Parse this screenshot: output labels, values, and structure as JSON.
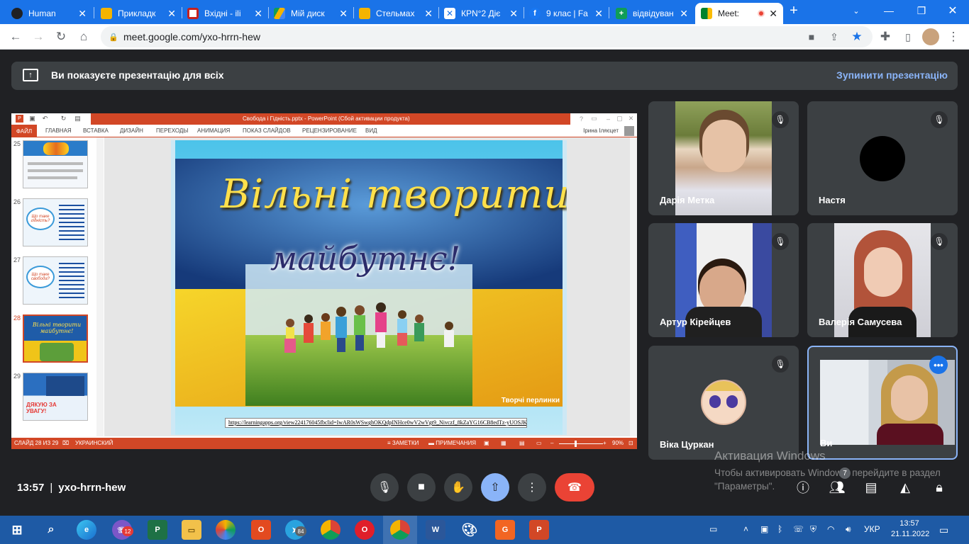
{
  "tabs": [
    {
      "title": "Human",
      "fav": "#5f6368",
      "active": false
    },
    {
      "title": "Прикладк",
      "fav": "#f4b400",
      "active": false
    },
    {
      "title": "Вхідні - ili",
      "fav": "#c5221f",
      "active": false
    },
    {
      "title": "Мій диск",
      "fav": "#0f9d58",
      "active": false
    },
    {
      "title": "Стельмах",
      "fav": "#f4b400",
      "active": false
    },
    {
      "title": "КРN°2 Діє",
      "fav": "#1a73e8",
      "active": false
    },
    {
      "title": "9 клас | Fa",
      "fav": "#1877f2",
      "active": false
    },
    {
      "title": "відвідуван",
      "fav": "#0f9d58",
      "active": false
    },
    {
      "title": "Meet:",
      "fav": "#00832d",
      "active": true
    }
  ],
  "address": {
    "url": "meet.google.com/yxo-hrrn-hew"
  },
  "banner": {
    "text": "Ви показуєте презентацію для всіх",
    "stop": "Зупинити презентацію"
  },
  "ppt": {
    "title": "Свобода і Гідність.pptx - PowerPoint (Сбой активации продукта)",
    "ribbon": {
      "file": "ФАЙЛ",
      "tabs": [
        "ГЛАВНАЯ",
        "ВСТАВКА",
        "ДИЗАЙН",
        "ПЕРЕХОДЫ",
        "АНИМАЦИЯ",
        "ПОКАЗ СЛАЙДОВ",
        "РЕЦЕНЗИРОВАНИЕ",
        "ВИД"
      ],
      "user": "Ірина Іляєцет"
    },
    "thumbs": [
      {
        "num": "25",
        "text": ""
      },
      {
        "num": "26",
        "text": "Що таке гідність?"
      },
      {
        "num": "27",
        "text": "Що таке свобода?"
      },
      {
        "num": "28",
        "text": "Вільні творити майбутнє!"
      },
      {
        "num": "29",
        "text": "ДЯКУЮ ЗА УВАГУ!"
      }
    ],
    "selected_slide": 28,
    "slide": {
      "title_line1": "Вільні творити",
      "title_line2": "майбутнє!",
      "caption": "Творчі перлинки",
      "link": "https://learningapps.org/view224176045fbclid=IwAR0sWSwghOKQdpINHce0wV2wVgt9_Nivczf_8kZaYG16CB8edTz-yUOSJKA"
    },
    "status": {
      "slide": "СЛАЙД 28 ИЗ 29",
      "lang": "УКРАИНСКИЙ",
      "notes": "ЗАМЕТКИ",
      "comments": "ПРИМЕЧАНИЯ",
      "zoom": "90%"
    }
  },
  "participants": [
    {
      "name": "Дарія Метка",
      "muted": true
    },
    {
      "name": "Настя",
      "muted": true
    },
    {
      "name": "Артур Кірейцев",
      "muted": true
    },
    {
      "name": "Валерія Самусева",
      "muted": true
    },
    {
      "name": "Віка Цуркан",
      "muted": true
    },
    {
      "name": "Ви",
      "muted": false
    }
  ],
  "footer": {
    "time": "13:57",
    "meeting_code": "yxo-hrrn-hew",
    "people_count": "7"
  },
  "watermark": {
    "line1": "Активация Windows",
    "line2": "Чтобы активировать Windows, перейдите в раздел \"Параметры\"."
  },
  "taskbar": {
    "viber_badge": "12",
    "telegram_badge": "84",
    "lang": "УКР",
    "time": "13:57",
    "date": "21.11.2022"
  },
  "colors": {
    "meet_bg": "#202124",
    "accent": "#8ab4f8",
    "leave": "#ea4335",
    "chrome_blue": "#1a73e8",
    "ppt_red": "#d24726"
  }
}
